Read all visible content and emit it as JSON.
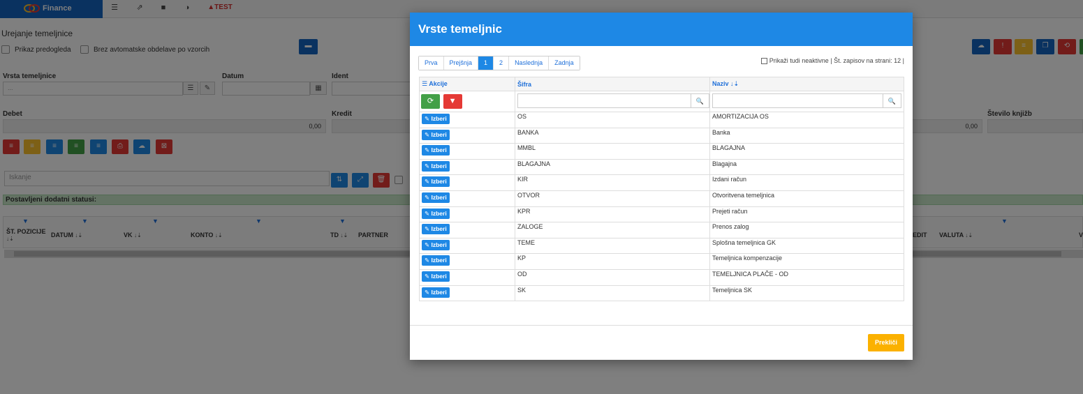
{
  "nav": {
    "brand": "Finance",
    "test_label": "TEST"
  },
  "page": {
    "title": "Urejanje temeljnice",
    "chk_preview": "Prikaz predogleda",
    "chk_auto": "Brez avtomatske obdelave po vzorcih"
  },
  "form": {
    "vrsta_label": "Vrsta temeljnice",
    "vrsta_value": "...",
    "datum_label": "Datum",
    "ident_label": "Ident",
    "debet_label": "Debet",
    "debet_value": "0,00",
    "kredit_label": "Kredit",
    "right_value": "0,00",
    "stevilo_label": "Število knjižb",
    "search_placeholder": "Iskanje"
  },
  "status_bar": "Postavljeni dodatni statusi:",
  "grid": {
    "columns": [
      "ŠT. POZICIJE",
      "DATUM",
      "VK",
      "KONTO",
      "TD",
      "PARTNER",
      "EDIT",
      "VALUTA",
      "V"
    ]
  },
  "modal": {
    "title": "Vrste temeljnic",
    "pager": [
      "Prva",
      "Prejšnja",
      "1",
      "2",
      "Naslednja",
      "Zadnja"
    ],
    "active_page": "1",
    "show_inactive": "Prikaži tudi neaktivne | Št. zapisov na strani: 12 |",
    "col_actions": "Akcije",
    "col_code": "Šifra",
    "col_name": "Naziv",
    "select_label": "Izberi",
    "cancel_label": "Prekliči",
    "rows": [
      {
        "code": "OS",
        "name": "AMORTIZACIJA OS"
      },
      {
        "code": "BANKA",
        "name": "Banka"
      },
      {
        "code": "MMBL",
        "name": "BLAGAJNA"
      },
      {
        "code": "BLAGAJNA",
        "name": "Blagajna"
      },
      {
        "code": "KIR",
        "name": "Izdani račun"
      },
      {
        "code": "OTVOR",
        "name": "Otvoritvena temeljnica"
      },
      {
        "code": "KPR",
        "name": "Prejeti račun"
      },
      {
        "code": "ZALOGE",
        "name": "Prenos zalog"
      },
      {
        "code": "TEME",
        "name": "Splošna temeljnica GK"
      },
      {
        "code": "KP",
        "name": "Temeljnica kompenzacije"
      },
      {
        "code": "OD",
        "name": "TEMELJNICA PLAČE - OD"
      },
      {
        "code": "SK",
        "name": "Temeljnica SK"
      }
    ]
  },
  "colors": {
    "primary": "#1e88e5",
    "danger": "#e53935",
    "warning": "#fbb100",
    "success": "#43a047"
  }
}
